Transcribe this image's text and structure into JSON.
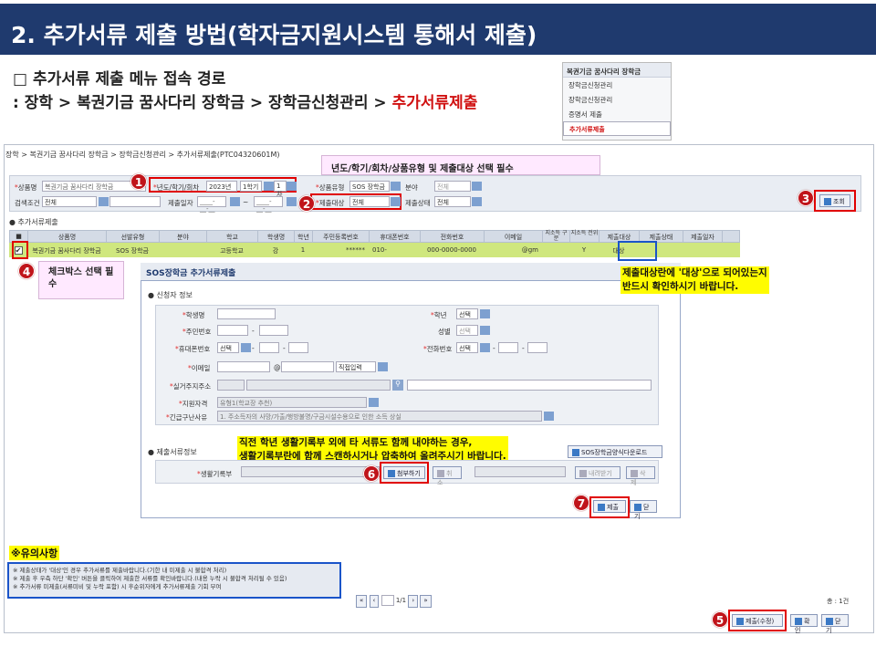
{
  "title": "2. 추가서류 제출 방법(학자금지원시스템 통해서 제출)",
  "route": {
    "line1": "□ 추가서류 제출 메뉴 접속 경로",
    "line2": " : 장학 > 복권기금 꿈사다리 장학금 > 장학금신청관리 > ",
    "line2_highlight": "추가서류제출"
  },
  "menu": {
    "header": "복권기금 꿈사다리 장학금",
    "items": [
      "장학금신청관리",
      "장학금신청관리",
      "증명서 제출",
      "추가서류제출"
    ]
  },
  "breadcrumb": "장학 > 복권기금 꿈사다리 장학금 > 장학금신청관리 > 추가서류제출(PTC04320601M)",
  "callouts": {
    "step1_note": "년도/학기/회차/상품유형 및 제출대상 선택 필수",
    "step4_note": "체크박스 선택 필수",
    "target_note_1": "제출대상란에 '대상'으로 되어있는지",
    "target_note_2": "반드시 확인하시기 바랍니다.",
    "attach_note_1": "직전 학년 생활기록부 외에 타 서류도 함께 내야하는 경우,",
    "attach_note_2": "생활기록부란에 함께 스캔하시거나 압축하여 올려주시기 바랍니다.",
    "caution_title": "※유의사항"
  },
  "badges": [
    "1",
    "2",
    "3",
    "4",
    "5",
    "6",
    "7"
  ],
  "search": {
    "product_label": "상품명",
    "product_value": "복권기금 꿈사다리 장학금",
    "year_label": "년도/학기/회차",
    "year_value": "2023년",
    "term_value": "1학기",
    "round_value": "1차",
    "type_label": "상품유형",
    "type_value": "SOS 장학금",
    "field_label": "분야",
    "field_value": "전체",
    "cond_label": "검색조건",
    "cond_value": "전체",
    "date_label": "제출일자",
    "date_from": "____-__-__",
    "date_tilde": "~",
    "date_to": "____-__-__",
    "target_label": "제출대상",
    "target_value": "전체",
    "status_label": "제출상태",
    "status_value": "전체",
    "search_btn": "조회"
  },
  "list_title": "추가서류제출",
  "grid": {
    "headers": [
      "상품명",
      "선발유형",
      "분야",
      "학교",
      "학생명",
      "학년",
      "주민등록번호",
      "휴대폰번호",
      "전화번호",
      "이메일",
      "지소득 구분",
      "지소득 전위",
      "제출대상",
      "제출상태",
      "제출일자"
    ],
    "row": [
      "복권기금 꿈사다리 장학금",
      "SOS 장학금",
      "",
      "고등학교",
      "강",
      "1",
      "******",
      "010-",
      "000-0000-0000",
      "@gm",
      "",
      "Y",
      "대상",
      "",
      ""
    ]
  },
  "popup": {
    "title": "SOS장학금 추가서류제출",
    "applicant_section": "신청자 정보",
    "labels": {
      "name": "학생명",
      "grade": "학년",
      "ssn": "주민번호",
      "gender": "성별",
      "mobile": "휴대폰번호",
      "phone": "전화번호",
      "email": "이메일",
      "address": "실거주지주소",
      "qualification": "지원자격",
      "reason": "긴급구난사유"
    },
    "values": {
      "grade": "선택",
      "gender": "선택",
      "mobile_sel": "선택",
      "phone_sel": "선택",
      "email_at": "@",
      "email_sel": "직접입력",
      "qualification": "유형1(학교장 추천)",
      "reason": "1. 주소득자의 사망/가출/행방불명/구금시설수용으로 인한 소득 상실",
      "dash": "-"
    },
    "docs_section": "제출서류정보",
    "form_btn": "SOS장학금양식다운로드",
    "record_label": "생활기록부",
    "attach_btn": "첨부하기",
    "cancel_btn": "취소",
    "download_btn": "내려받기",
    "delete_btn": "삭제",
    "submit_btn": "제출",
    "close_btn": "닫기"
  },
  "notes": [
    "※ 제출상태가 '대상'인 경우 추가서류를 제출바랍니다.(기한 내 미제출 시 불합격 처리)",
    "※ 제출 후 우측 하단 '확인' 버튼을 클릭하여 제출한 서류를 확인바랍니다.(내용 누락 시 불합격 처리될 수 있음)",
    "※ 추가서류 미제출(서류미비 및 누락 포함) 시 후순위자에게 추가서류제출 기회 부여"
  ],
  "pager": {
    "page": "1/1",
    "total": "총 : 1건"
  },
  "bottom_buttons": {
    "submit_edit": "제출(수정)",
    "confirm": "확인",
    "close": "닫기"
  }
}
